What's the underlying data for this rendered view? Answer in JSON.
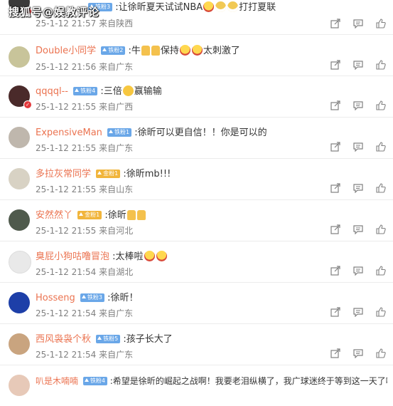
{
  "watermark": "搜狐号@娱教评论",
  "comments": [
    {
      "avatar": "avatar",
      "username": "",
      "fan_badge": "铁粉3",
      "text_parts": [
        ":让徐昕夏天试试NBA",
        "",
        "",
        "打打夏联"
      ],
      "time": "25-1-12 21:57",
      "location": "来自陕西"
    },
    {
      "avatar": "avatar",
      "username": "Double小同学",
      "fan_badge": "铁粉2",
      "text_parts": [
        ":牛",
        "",
        "保持",
        "",
        "太刺激了"
      ],
      "time": "25-1-12 21:56",
      "location": "来自广东"
    },
    {
      "avatar": "avatar",
      "username": "qqqql--",
      "fan_badge": "铁粉4",
      "text_parts": [
        ":三倍",
        "赢输输"
      ],
      "time": "25-1-12 21:55",
      "location": "来自广西"
    },
    {
      "avatar": "avatar",
      "username": "ExpensiveMan",
      "fan_badge": "铁粉1",
      "text_parts": [
        ":徐昕可以更自信！！你是可以的"
      ],
      "time": "25-1-12 21:55",
      "location": "来自广东"
    },
    {
      "avatar": "avatar",
      "username": "多拉灰常同学",
      "fan_badge": "金粉1",
      "text_parts": [
        ":徐昕mb!!!"
      ],
      "time": "25-1-12 21:55",
      "location": "来自山东"
    },
    {
      "avatar": "avatar",
      "username": "安然然丫",
      "fan_badge": "金粉1",
      "text_parts": [
        ":徐昕"
      ],
      "time": "25-1-12 21:55",
      "location": "来自河北"
    },
    {
      "avatar": "avatar",
      "username": "臭屁小狗咕噜冒泡",
      "fan_badge": "",
      "text_parts": [
        ":太棒啦"
      ],
      "time": "25-1-12 21:54",
      "location": "来自湖北"
    },
    {
      "avatar": "avatar",
      "username": "Hosseng",
      "fan_badge": "铁粉3",
      "text_parts": [
        ":徐昕！"
      ],
      "time": "25-1-12 21:54",
      "location": "来自广东"
    },
    {
      "avatar": "avatar",
      "username": "西风袅袅个秋",
      "fan_badge": "铁粉5",
      "text_parts": [
        ":孩子长大了"
      ],
      "time": "25-1-12 21:54",
      "location": "来自广东"
    },
    {
      "avatar": "avatar",
      "username": "叭是木喃喃",
      "fan_badge": "铁粉4",
      "text_parts": [
        ":希望是徐昕的崛起之战啊！我要老泪纵横了，我广球迷终于等到这一天了吗"
      ],
      "time": "",
      "location": ""
    }
  ],
  "actions": {
    "share_icon": "share-icon",
    "comment_icon": "comment-icon",
    "like_icon": "like-icon"
  },
  "colors": {
    "username": "#eb7350",
    "meta": "#808080",
    "fan_badge_blue": "#6aa7e8",
    "fan_badge_gold": "#f1b53c"
  }
}
